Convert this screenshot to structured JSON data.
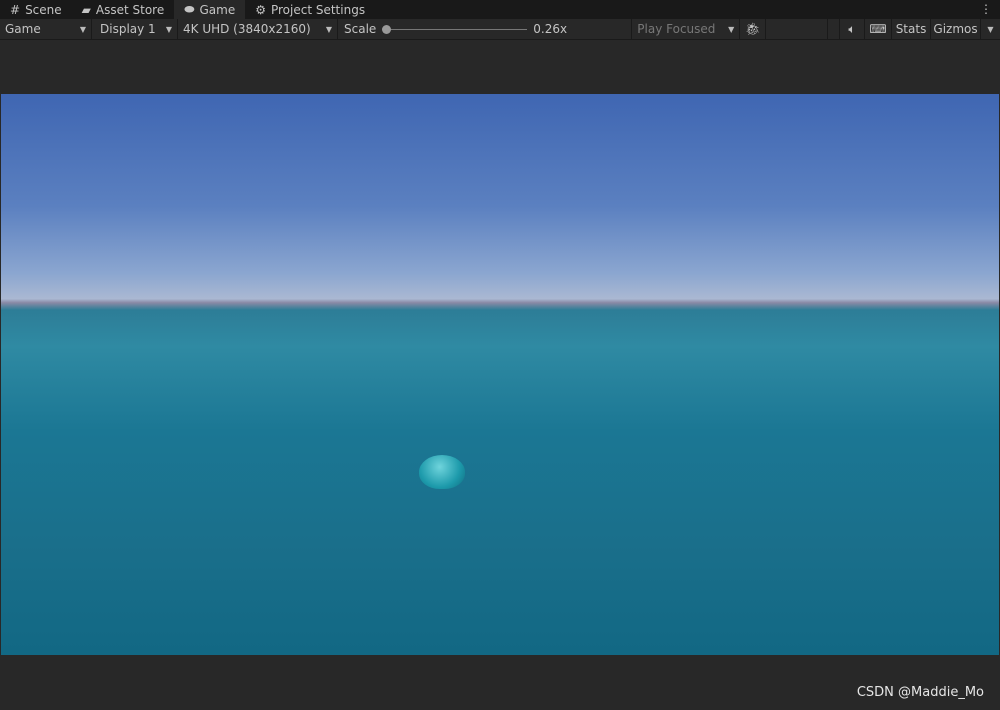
{
  "tabs": [
    {
      "label": "Scene",
      "icon": "grid-icon"
    },
    {
      "label": "Asset Store",
      "icon": "bag-icon"
    },
    {
      "label": "Game",
      "icon": "gamepad-icon",
      "active": true
    },
    {
      "label": "Project Settings",
      "icon": "gear-icon"
    }
  ],
  "toolbar": {
    "view_mode": "Game",
    "display": "Display 1",
    "resolution": "4K UHD (3840x2160)",
    "scale_label": "Scale",
    "scale_value": "0.26x",
    "scale_fraction": 0.0,
    "play_mode": "Play Focused",
    "stats": "Stats",
    "gizmos": "Gizmos"
  },
  "watermark": "CSDN @Maddie_Mo"
}
